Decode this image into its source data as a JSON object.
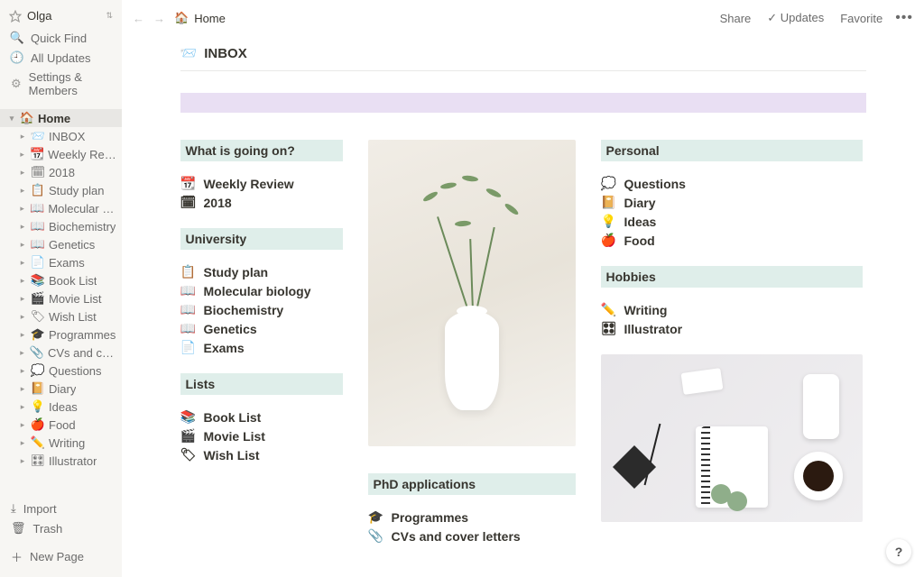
{
  "workspace": {
    "name": "Olga"
  },
  "sidebar_utils": {
    "quick_find": "Quick Find",
    "all_updates": "All Updates",
    "settings": "Settings & Members"
  },
  "tree_root": {
    "label": "Home",
    "icon": "🏠"
  },
  "tree_children": [
    {
      "label": "INBOX",
      "icon": "📨"
    },
    {
      "label": "Weekly Revi…",
      "icon": "📆"
    },
    {
      "label": "2018",
      "icon": "🗓"
    },
    {
      "label": "Study plan",
      "icon": "📋"
    },
    {
      "label": "Molecular bi…",
      "icon": "📖"
    },
    {
      "label": "Biochemistry",
      "icon": "📖"
    },
    {
      "label": "Genetics",
      "icon": "📖"
    },
    {
      "label": "Exams",
      "icon": "📄"
    },
    {
      "label": "Book List",
      "icon": "📚"
    },
    {
      "label": "Movie List",
      "icon": "🎬"
    },
    {
      "label": "Wish List",
      "icon": "🏷"
    },
    {
      "label": "Programmes",
      "icon": "🎓"
    },
    {
      "label": "CVs and cov…",
      "icon": "📎"
    },
    {
      "label": "Questions",
      "icon": "💭"
    },
    {
      "label": "Diary",
      "icon": "📔"
    },
    {
      "label": "Ideas",
      "icon": "💡"
    },
    {
      "label": "Food",
      "icon": "🍎"
    },
    {
      "label": "Writing",
      "icon": "✏️"
    },
    {
      "label": "Illustrator",
      "icon": "🎛"
    }
  ],
  "sidebar_bottom": {
    "import": "Import",
    "trash": "Trash",
    "new_page": "New Page"
  },
  "topbar": {
    "breadcrumb": "Home",
    "share": "Share",
    "updates": "Updates",
    "favorite": "Favorite"
  },
  "page": {
    "inbox_title": "INBOX",
    "sections": {
      "whats_going_on": "What is going on?",
      "university": "University",
      "lists": "Lists",
      "phd": "PhD applications",
      "personal": "Personal",
      "hobbies": "Hobbies"
    },
    "links": {
      "weekly_review": "Weekly Review",
      "y2018": "2018",
      "study_plan": "Study plan",
      "molecular_biology": "Molecular biology",
      "biochemistry": "Biochemistry",
      "genetics": "Genetics",
      "exams": "Exams",
      "book_list": "Book List",
      "movie_list": "Movie List",
      "wish_list": "Wish List",
      "programmes": "Programmes",
      "cvs": "CVs and cover letters",
      "questions": "Questions",
      "diary": "Diary",
      "ideas": "Ideas",
      "food": "Food",
      "writing": "Writing",
      "illustrator": "Illustrator"
    }
  },
  "help": "?"
}
